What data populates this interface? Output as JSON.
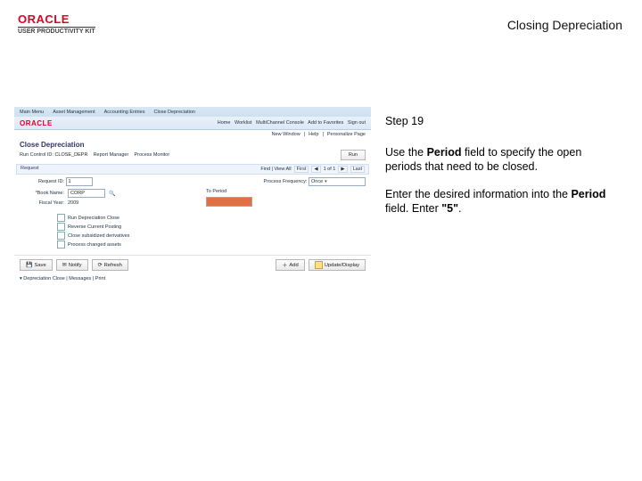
{
  "header": {
    "brand": "ORACLE",
    "subbrand": "USER PRODUCTIVITY KIT",
    "title": "Closing Depreciation"
  },
  "instructions": {
    "step_label": "Step 19",
    "para1_a": "Use the ",
    "para1_bold1": "Period",
    "para1_b": " field to specify the open periods that need to be closed.",
    "para2_a": "Enter the desired information into the ",
    "para2_bold1": "Period",
    "para2_b": " field. Enter ",
    "para2_bold2": "\"5\"",
    "para2_c": "."
  },
  "app": {
    "tabs": [
      "Main Menu",
      "Asset Management",
      "Accounting Entries",
      "Close Depreciation"
    ],
    "header_links": [
      "Home",
      "Worklist",
      "MultiChannel Console",
      "Add to Favorites",
      "Sign out"
    ],
    "brand": "ORACLE",
    "meta_links": [
      "New Window",
      "Help",
      "Personalize Page"
    ],
    "page_title": "Close Depreciation",
    "run_control": {
      "label": "Run Control ID:",
      "value": "CLOSE_DEPR",
      "link": "Report Manager",
      "pm": "Process Monitor"
    },
    "run_btn": "Run",
    "section": {
      "title": "Request",
      "pager": {
        "find": "Find | View All",
        "first": "First",
        "pos": "1 of 1",
        "last": "Last"
      }
    },
    "form": {
      "request_id_label": "Request ID:",
      "request_id": "1",
      "process_freq_label": "Process Frequency:",
      "process_freq": "Once",
      "book_label": "*Book Name:",
      "book": "CORP",
      "to_period_label": "To Period",
      "fy_label": "Fiscal Year:",
      "fy": "2009"
    },
    "options": [
      "Run Depreciation Close",
      "Reverse Current Posting",
      "Close subsidized derivatives",
      "Process changed assets"
    ],
    "bottom_buttons": {
      "save": "Save",
      "notify": "Notify",
      "refresh": "Refresh",
      "add": "Add",
      "update": "Update/Display"
    },
    "footer": "▾ Depreciation Close | Messages | Print"
  }
}
